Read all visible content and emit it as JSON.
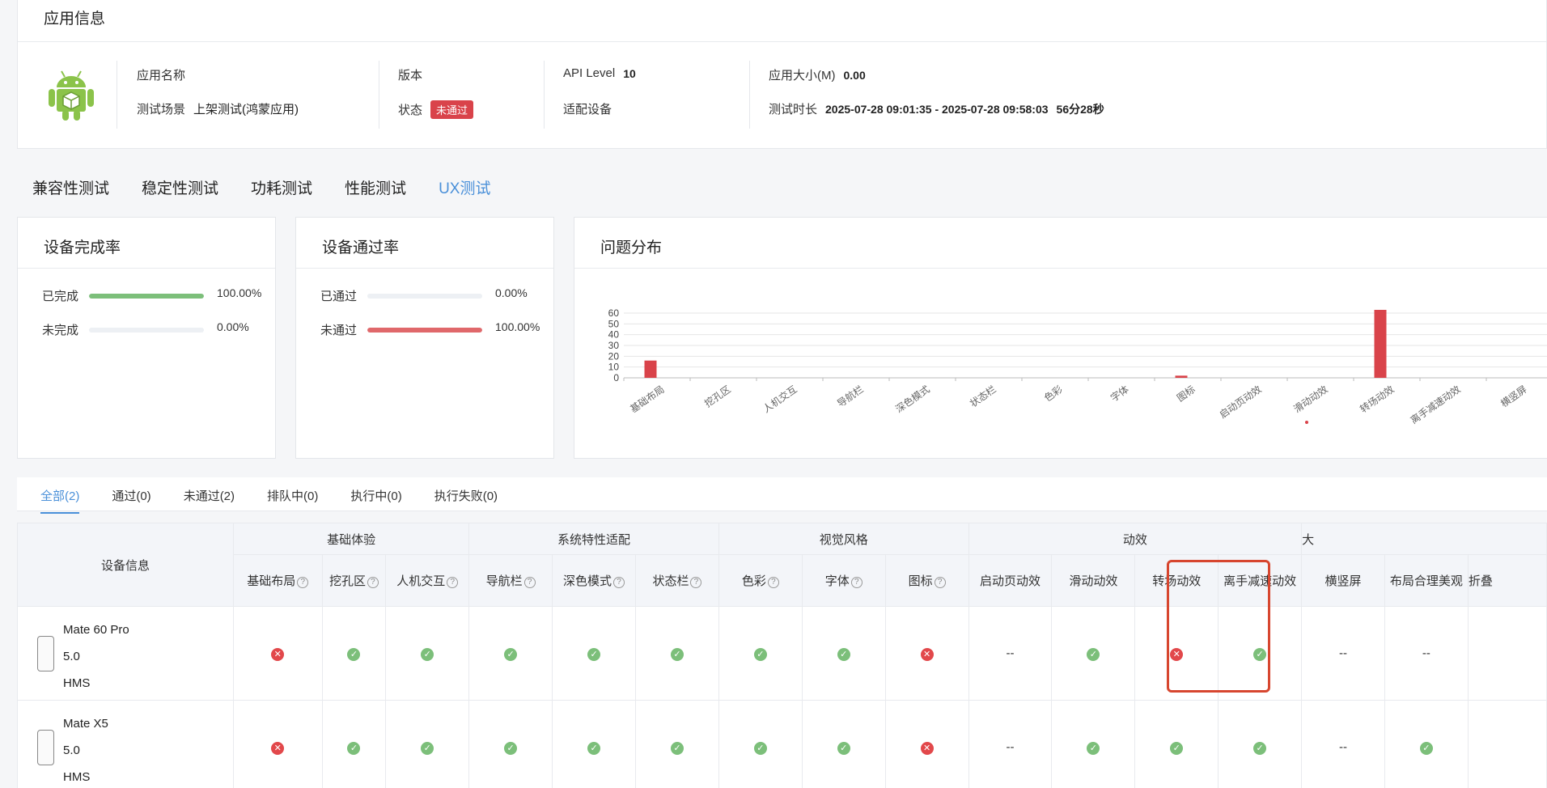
{
  "app_info": {
    "title": "应用信息",
    "name_label": "应用名称",
    "scene_label": "测试场景",
    "scene_value": "上架测试(鸿蒙应用)",
    "version_label": "版本",
    "status_label": "状态",
    "status_value": "未通过",
    "api_label": "API Level",
    "api_value": "10",
    "adapt_label": "适配设备",
    "size_label": "应用大小(M)",
    "size_value": "0.00",
    "duration_label": "测试时长",
    "duration_value": "2025-07-28 09:01:35 - 2025-07-28 09:58:03",
    "duration_total": "56分28秒",
    "icon": "android-robot-icon"
  },
  "test_tabs": [
    "兼容性测试",
    "稳定性测试",
    "功耗测试",
    "性能测试",
    "UX测试"
  ],
  "active_test_tab": "UX测试",
  "completion_card": {
    "title": "设备完成率",
    "rows": [
      {
        "label": "已完成",
        "value": "100.00%",
        "fraction": 1.0,
        "color": "#7cbf7a"
      },
      {
        "label": "未完成",
        "value": "0.00%",
        "fraction": 0.0,
        "color": "#7cbf7a"
      }
    ]
  },
  "pass_card": {
    "title": "设备通过率",
    "rows": [
      {
        "label": "已通过",
        "value": "0.00%",
        "fraction": 0.0,
        "color": "#e0686b"
      },
      {
        "label": "未通过",
        "value": "100.00%",
        "fraction": 1.0,
        "color": "#e0686b"
      }
    ]
  },
  "issue_card": {
    "title": "问题分布"
  },
  "chart_data": {
    "type": "bar",
    "categories": [
      "基础布局",
      "挖孔区",
      "人机交互",
      "导航栏",
      "深色模式",
      "状态栏",
      "色彩",
      "字体",
      "图标",
      "启动页动效",
      "滑动动效",
      "转场动效",
      "离手减速动效",
      "横竖屏"
    ],
    "values": [
      16,
      0,
      0,
      0,
      0,
      0,
      0,
      0,
      2,
      0,
      0,
      63,
      0,
      0
    ],
    "yticks": [
      0,
      10,
      20,
      30,
      40,
      50,
      60
    ],
    "ylim": [
      0,
      63
    ],
    "grid": true,
    "bar_color": "#d9434a"
  },
  "filter_tabs": [
    "全部(2)",
    "通过(0)",
    "未通过(2)",
    "排队中(0)",
    "执行中(0)",
    "执行失败(0)"
  ],
  "table": {
    "device_header": "设备信息",
    "groups": [
      {
        "label": "基础体验",
        "span": 3
      },
      {
        "label": "系统特性适配",
        "span": 3
      },
      {
        "label": "视觉风格",
        "span": 3
      },
      {
        "label": "动效",
        "span": 4
      },
      {
        "label": "大",
        "span": 3
      }
    ],
    "columns": [
      {
        "label": "基础布局",
        "help": true
      },
      {
        "label": "挖孔区",
        "help": true
      },
      {
        "label": "人机交互",
        "help": true
      },
      {
        "label": "导航栏",
        "help": true
      },
      {
        "label": "深色模式",
        "help": true
      },
      {
        "label": "状态栏",
        "help": true
      },
      {
        "label": "色彩",
        "help": true
      },
      {
        "label": "字体",
        "help": true
      },
      {
        "label": "图标",
        "help": true
      },
      {
        "label": "启动页动效",
        "help": false
      },
      {
        "label": "滑动动效",
        "help": false
      },
      {
        "label": "转场动效",
        "help": false
      },
      {
        "label": "离手减速动效",
        "help": false
      },
      {
        "label": "横竖屏",
        "help": false
      },
      {
        "label": "布局合理美观",
        "help": false
      },
      {
        "label": "折叠",
        "help": false
      }
    ],
    "rows": [
      {
        "device": "Mate 60 Pro",
        "version": "5.0",
        "os": "HMS",
        "results": [
          "fail",
          "pass",
          "pass",
          "pass",
          "pass",
          "pass",
          "pass",
          "pass",
          "fail",
          "none",
          "pass",
          "fail",
          "pass",
          "none",
          "none",
          ""
        ]
      },
      {
        "device": "Mate X5",
        "version": "5.0",
        "os": "HMS",
        "results": [
          "fail",
          "pass",
          "pass",
          "pass",
          "pass",
          "pass",
          "pass",
          "pass",
          "fail",
          "none",
          "pass",
          "pass",
          "pass",
          "none",
          "pass",
          ""
        ]
      }
    ],
    "dash_text": "--"
  }
}
